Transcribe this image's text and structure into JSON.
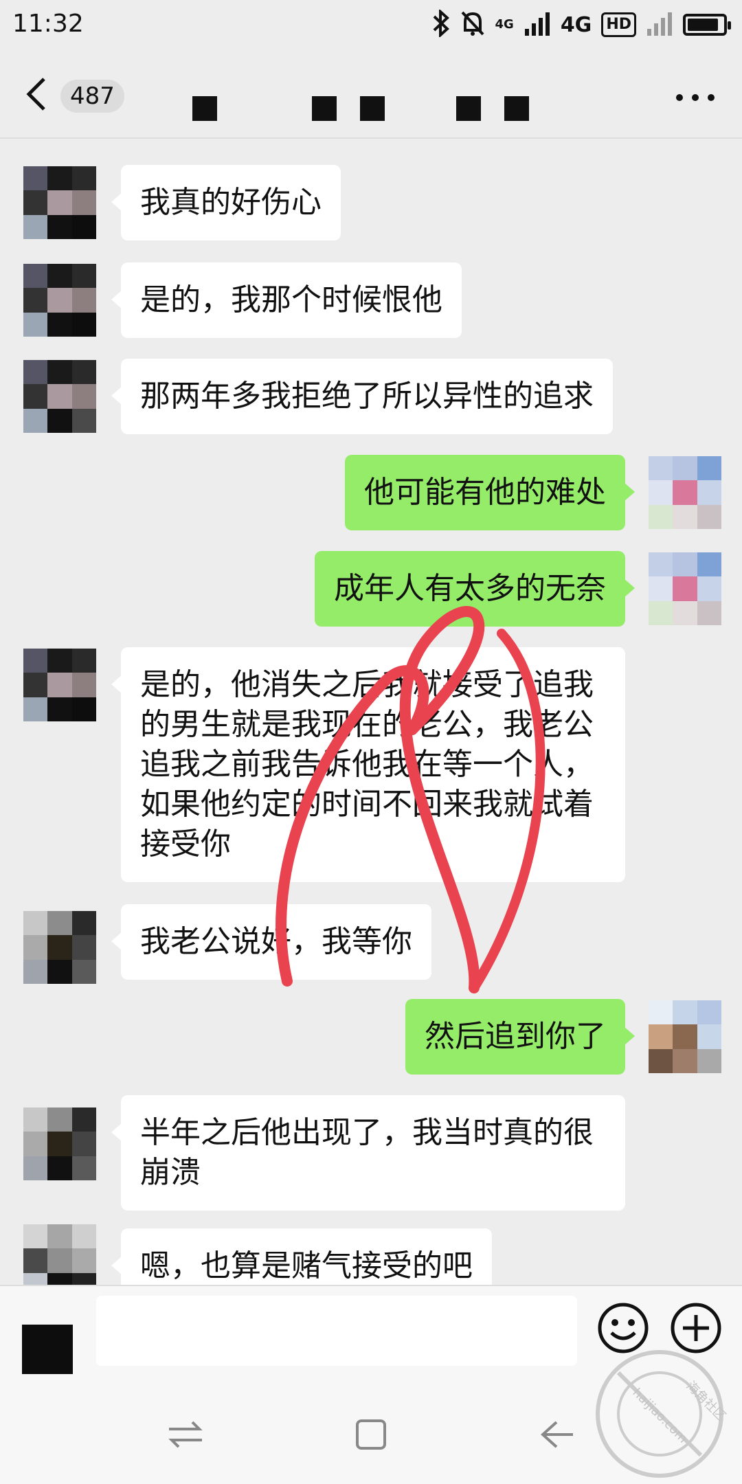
{
  "status_bar": {
    "time": "11:32",
    "network_label": "4G",
    "network_small": "4G",
    "hd_label": "HD",
    "icons": [
      "bluetooth-icon",
      "mute-icon",
      "signal-icon",
      "battery-icon"
    ]
  },
  "header": {
    "unread_count": "487",
    "title_redacted": true
  },
  "messages": [
    {
      "side": "left",
      "text": "我真的好伤心"
    },
    {
      "side": "left",
      "text": "是的，我那个时候恨他"
    },
    {
      "side": "left",
      "text": "那两年多我拒绝了所以异性的追求"
    },
    {
      "side": "right",
      "text": "他可能有他的难处"
    },
    {
      "side": "right",
      "text": "成年人有太多的无奈"
    },
    {
      "side": "left",
      "text": "是的，他消失之后我就接受了追我的男生就是我现在的老公，我老公追我之前我告诉他我在等一个人，如果他约定的时间不回来我就试着接受你"
    },
    {
      "side": "left",
      "text": "我老公说好，我等你"
    },
    {
      "side": "right",
      "text": "然后追到你了"
    },
    {
      "side": "left",
      "text": "半年之后他出现了，我当时真的很崩溃"
    },
    {
      "side": "left",
      "text": "嗯，也算是赌气接受的吧"
    }
  ],
  "input": {
    "value": "",
    "placeholder": ""
  },
  "watermark": {
    "text_line1": "海角社区",
    "text_line2": "haijiao.com"
  },
  "colors": {
    "background": "#ededed",
    "my_bubble": "#95ec69",
    "their_bubble": "#ffffff",
    "scribble": "#e8434f"
  }
}
